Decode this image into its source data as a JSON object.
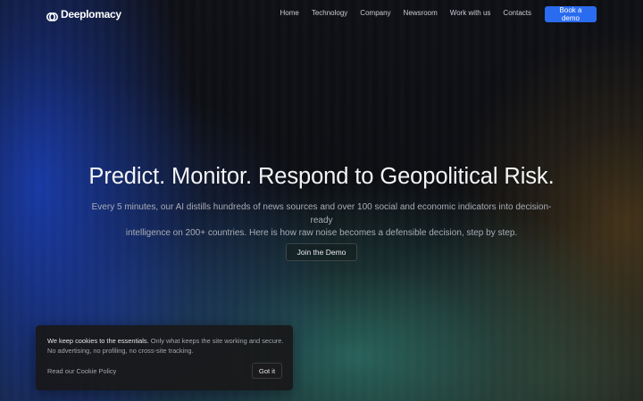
{
  "brand": {
    "name": "Deeplomacy",
    "logo_icon": "deeplomacy-logo-icon"
  },
  "nav": {
    "items": [
      {
        "label": "Home"
      },
      {
        "label": "Technology"
      },
      {
        "label": "Company"
      },
      {
        "label": "Newsroom"
      },
      {
        "label": "Work with us"
      },
      {
        "label": "Contacts"
      }
    ],
    "cta_label": "Book a demo"
  },
  "hero": {
    "title": "Predict. Monitor. Respond to Geopolitical Risk.",
    "subtitle_line1": "Every 5 minutes, our AI distills hundreds of news sources and over 100 social and economic indicators into decision-ready",
    "subtitle_line2": "intelligence on 200+ countries. Here is how raw noise becomes a defensible decision, step by step.",
    "cta_label": "Join the Demo"
  },
  "cookie": {
    "heading": "We keep cookies to the essentials.",
    "body": " Only what keeps the site working and secure. No advertising, no profiling, no cross-site tracking.",
    "policy_link": "Read our Cookie Policy",
    "accept_label": "Got it"
  },
  "colors": {
    "accent": "#2a6cf0",
    "background": "#0c0d10"
  }
}
